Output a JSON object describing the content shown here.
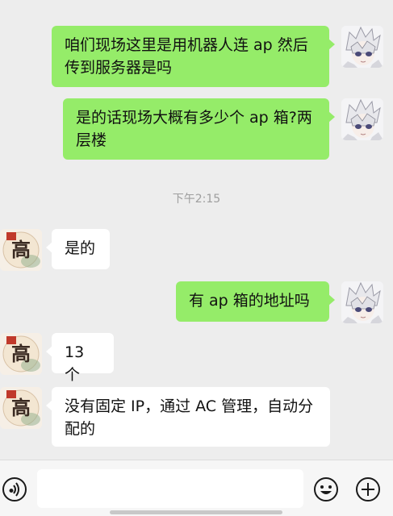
{
  "messages": [
    {
      "side": "me",
      "text": "咱们现场这里是用机器人连 ap 然后传到服务器是吗"
    },
    {
      "side": "me",
      "text": "是的话现场大概有多少个 ap 箱?两层楼"
    },
    {
      "side": "them",
      "text": "是的"
    },
    {
      "side": "me",
      "text": "有 ap 箱的地址吗"
    },
    {
      "side": "them",
      "text": "13 个"
    },
    {
      "side": "them",
      "text": "没有固定 IP，通过 AC 管理，自动分配的"
    }
  ],
  "timestamp": "下午2:15",
  "avatars": {
    "them_seal_char": "高"
  },
  "input_bar": {
    "voice_icon": "voice-icon",
    "emoji_icon": "emoji-icon",
    "plus_icon": "plus-icon",
    "value": ""
  },
  "colors": {
    "background": "#ededed",
    "my_bubble": "#95ec69",
    "their_bubble": "#ffffff",
    "timestamp": "#9e9e9e"
  }
}
